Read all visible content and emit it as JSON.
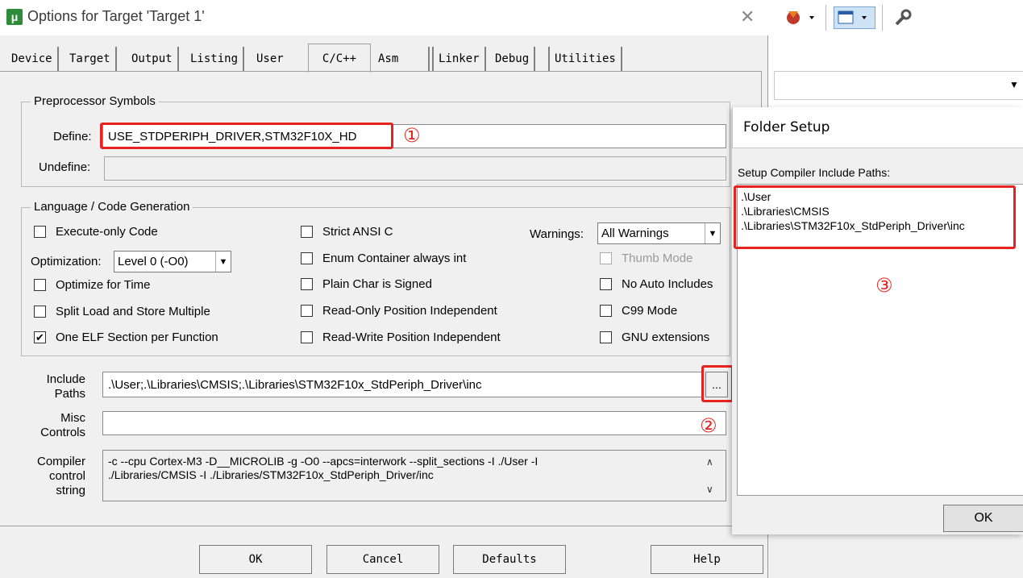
{
  "dialog": {
    "title": "Options for Target 'Target 1'",
    "tabs": [
      "Device",
      "Target",
      "Output",
      "Listing",
      "User",
      "C/C++",
      "Asm",
      "Linker",
      "Debug",
      "Utilities"
    ],
    "active_tab": "C/C++"
  },
  "preprocessor": {
    "group_label": "Preprocessor Symbols",
    "define_label": "Define:",
    "define_value": "USE_STDPERIPH_DRIVER,STM32F10X_HD",
    "undefine_label": "Undefine:",
    "undefine_value": ""
  },
  "codegen": {
    "group_label": "Language / Code Generation",
    "execute_only": "Execute-only Code",
    "optimization_label": "Optimization:",
    "optimization_value": "Level 0 (-O0)",
    "optimize_time": "Optimize for Time",
    "split_load": "Split Load and Store Multiple",
    "one_elf": "One ELF Section per Function",
    "strict_ansi": "Strict ANSI C",
    "enum_container": "Enum Container always int",
    "plain_char": "Plain Char is Signed",
    "ropi": "Read-Only Position Independent",
    "rwpi": "Read-Write Position Independent",
    "warnings_label": "Warnings:",
    "warnings_value": "All Warnings",
    "thumb_mode": "Thumb Mode",
    "no_auto": "No Auto Includes",
    "c99": "C99 Mode",
    "gnu": "GNU extensions"
  },
  "paths": {
    "include_label_1": "Include",
    "include_label_2": "Paths",
    "include_value": ".\\User;.\\Libraries\\CMSIS;.\\Libraries\\STM32F10x_StdPeriph_Driver\\inc",
    "browse_label": "...",
    "misc_label_1": "Misc",
    "misc_label_2": "Controls",
    "misc_value": "",
    "compiler_label_1": "Compiler",
    "compiler_label_2": "control",
    "compiler_label_3": "string",
    "compiler_line_1": "-c --cpu Cortex-M3 -D__MICROLIB -g -O0 --apcs=interwork --split_sections -I ./User -I",
    "compiler_line_2": "./Libraries/CMSIS -I ./Libraries/STM32F10x_StdPeriph_Driver/inc"
  },
  "buttons": {
    "ok": "OK",
    "cancel": "Cancel",
    "defaults": "Defaults",
    "help": "Help"
  },
  "folder_setup": {
    "title": "Folder Setup",
    "label": "Setup Compiler Include Paths:",
    "paths": [
      ".\\User",
      ".\\Libraries\\CMSIS",
      ".\\Libraries\\STM32F10x_StdPeriph_Driver\\inc"
    ],
    "ok": "OK"
  },
  "annotations": {
    "one": "①",
    "two": "②",
    "three": "③"
  },
  "colors": {
    "annotation": "#e8231f",
    "logo": "#2e8b3a"
  },
  "icons": {
    "app_logo": "keil-logo-icon",
    "close": "close-icon"
  }
}
